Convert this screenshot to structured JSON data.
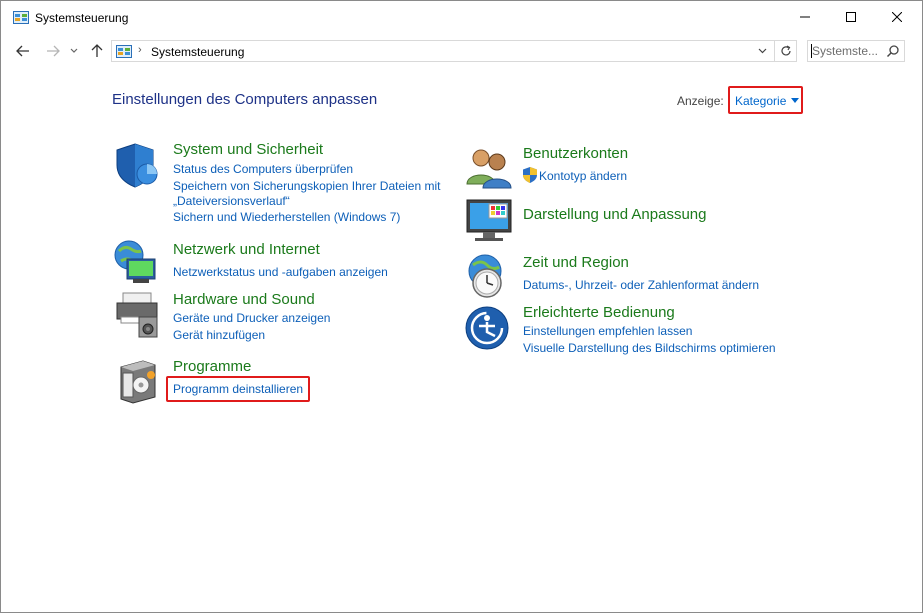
{
  "window": {
    "title": "Systemsteuerung"
  },
  "nav": {
    "address_path": "Systemsteuerung",
    "search_placeholder": "Systemste..."
  },
  "main": {
    "heading": "Einstellungen des Computers anpassen",
    "view_label": "Anzeige:",
    "view_value": "Kategorie"
  },
  "categories": {
    "system": {
      "title": "System und Sicherheit",
      "links": [
        "Status des Computers überprüfen",
        "Speichern von Sicherungskopien Ihrer Dateien mit",
        "„Dateiversionsverlauf“",
        "Sichern und Wiederherstellen (Windows 7)"
      ]
    },
    "network": {
      "title": "Netzwerk und Internet",
      "links": [
        "Netzwerkstatus und -aufgaben anzeigen"
      ]
    },
    "hardware": {
      "title": "Hardware und Sound",
      "links": [
        "Geräte und Drucker anzeigen",
        "Gerät hinzufügen"
      ]
    },
    "programs": {
      "title": "Programme",
      "links": [
        "Programm deinstallieren"
      ]
    },
    "users": {
      "title": "Benutzerkonten",
      "links": [
        "Kontotyp ändern"
      ]
    },
    "appearance": {
      "title": "Darstellung und Anpassung"
    },
    "clock": {
      "title": "Zeit und Region",
      "links": [
        "Datums-, Uhrzeit- oder Zahlenformat ändern"
      ]
    },
    "ease": {
      "title": "Erleichterte Bedienung",
      "links": [
        "Einstellungen empfehlen lassen",
        "Visuelle Darstellung des Bildschirms optimieren"
      ]
    }
  },
  "colors": {
    "heading": "#1e3287",
    "category_title": "#1b7a1b",
    "link": "#0d5fb8",
    "highlight": "#e01b1b"
  }
}
